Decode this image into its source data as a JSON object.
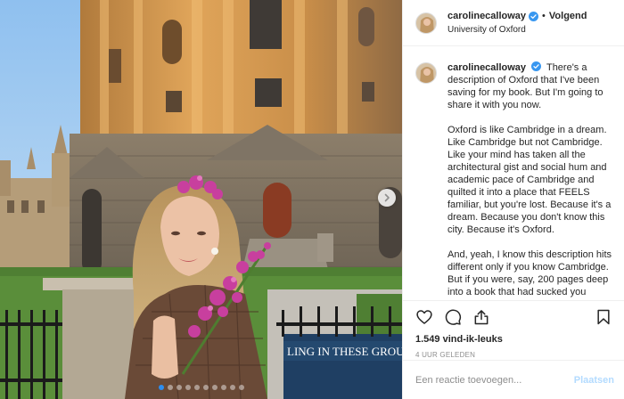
{
  "post": {
    "username": "carolinecalloway",
    "verified": true,
    "follow_label": "Volgend",
    "separator": "•",
    "location": "University of Oxford",
    "caption": {
      "username": "carolinecalloway",
      "paragraphs": [
        "There's a description of Oxford that I've been saving for my book. But I'm going to share it with you now.",
        "Oxford is like Cambridge in a dream. Like Cambridge but not Cambridge. Like your mind has taken all the architectural gist and social hum and academic pace of Cambridge and quilted it into a place that FEELS familiar, but you're lost. Because it's a dream. Because you don't know this city. Because it's Oxford.",
        "And, yeah, I know this description hits different only if you know Cambridge. But if you were, say, 200 pages deep into a book that had sucked you through a vacuum hose into the world"
      ]
    },
    "likes": "1.549 vind-ik-leuks",
    "time": "4 UUR GELEDEN",
    "comment_placeholder": "Een reactie toevoegen...",
    "post_button": "Plaatsen",
    "photo_sign_text": "LING IN THESE GROU",
    "carousel": {
      "count": 10,
      "active_index": 0
    }
  },
  "icons": {
    "verified": "verified-badge-icon",
    "like": "heart-icon",
    "comment": "comment-bubble-icon",
    "share": "share-icon",
    "save": "bookmark-icon",
    "next": "chevron-right-icon"
  },
  "colors": {
    "verified_blue": "#3897f0",
    "text": "#262626",
    "muted": "#8e8e8e",
    "post_button_disabled": "#b3dbff",
    "carousel_active": "#2d8ef0"
  }
}
